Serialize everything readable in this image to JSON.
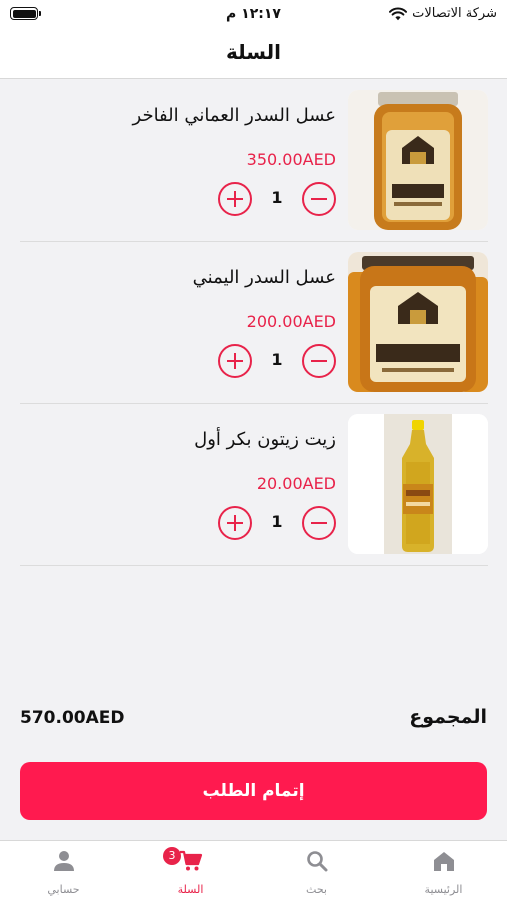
{
  "status_bar": {
    "carrier": "شركة الاتصالات",
    "time": "١٢:١٧ م"
  },
  "header": {
    "title": "السلة"
  },
  "cart": {
    "items": [
      {
        "name": "عسل السدر العماني الفاخر",
        "price": "350.00AED",
        "quantity": "1",
        "image": "honey-jar-dark-label"
      },
      {
        "name": "عسل السدر اليمني",
        "price": "200.00AED",
        "quantity": "1",
        "image": "honey-jars-group"
      },
      {
        "name": "زيت زيتون بكر أول",
        "price": "20.00AED",
        "quantity": "1",
        "image": "olive-oil-bottle"
      }
    ]
  },
  "summary": {
    "total_label": "المجموع",
    "total_value": "570.00AED"
  },
  "checkout": {
    "label": "إتمام الطلب"
  },
  "tabbar": {
    "tabs": [
      {
        "label": "الرئيسية",
        "icon": "home-icon"
      },
      {
        "label": "بحث",
        "icon": "search-icon"
      },
      {
        "label": "السلة",
        "icon": "cart-icon",
        "badge": "3",
        "active": true
      },
      {
        "label": "حسابي",
        "icon": "person-icon"
      }
    ]
  },
  "colors": {
    "accent": "#e8234a",
    "checkout_button": "#ff1a4f",
    "background": "#f2f2f4",
    "inactive_tab": "#8e8e93"
  }
}
